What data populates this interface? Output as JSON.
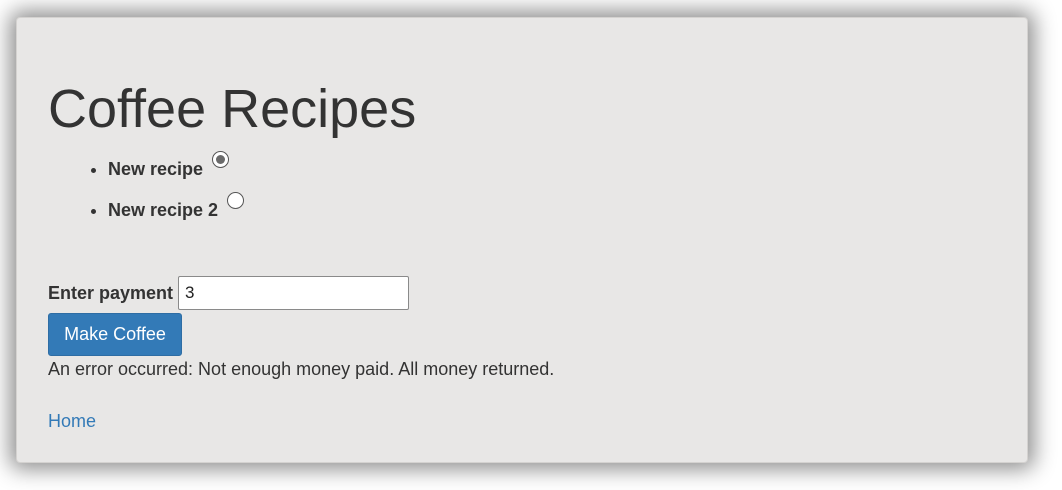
{
  "page": {
    "title": "Coffee Recipes"
  },
  "recipes": [
    {
      "label": "New recipe",
      "selected": true
    },
    {
      "label": "New recipe 2",
      "selected": false
    }
  ],
  "payment": {
    "label": "Enter payment",
    "value": "3"
  },
  "actions": {
    "make_coffee_label": "Make Coffee"
  },
  "status": {
    "message": "An error occurred: Not enough money paid. All money returned."
  },
  "nav": {
    "home_label": "Home"
  },
  "colors": {
    "panel_background": "#e8e7e6",
    "primary_button": "#337ab7",
    "link": "#337ab7",
    "text": "#333333"
  }
}
